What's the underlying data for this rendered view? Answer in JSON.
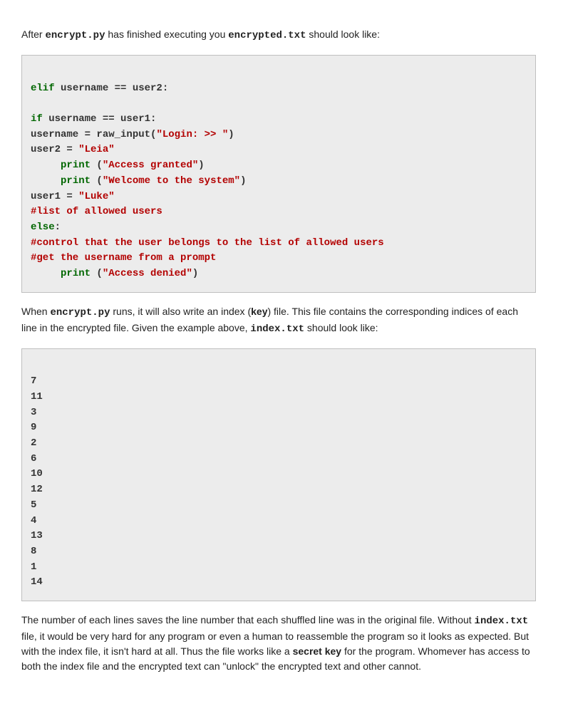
{
  "paragraphs": {
    "p1_t1": "After ",
    "p1_c1": "encrypt.py",
    "p1_t2": " has finished  executing you ",
    "p1_c2": "encrypted.txt",
    "p1_t3": " should look like:",
    "p2_t1": "When ",
    "p2_c1": "encrypt.py",
    "p2_t2": " runs, it will also write an index (",
    "p2_b1": "key",
    "p2_t3": ") file. This file contains the corresponding indices of each line in the encrypted file. Given the example above, ",
    "p2_c2": "index.txt",
    "p2_t4": " should look like:",
    "p3_t1": "The number of each lines saves the line number that each shuffled line was in the original file. Without ",
    "p3_c1": "index.txt",
    "p3_t2": " file, it would be very hard for any program or even a human to reassemble the program so it looks as expected. But with the index file, it isn't hard at all. Thus the file works like a ",
    "p3_b1": "secret key",
    "p3_t3": " for the program. Whomever has access to both the index file and the encrypted text can \"unlock\" the encrypted text and other cannot."
  },
  "code1": {
    "l1_kw": "elif",
    "l1_rest": " username == user2:",
    "l2_kw": "if",
    "l2_rest": " username == user1:",
    "l3_a": "username = raw_input(",
    "l3_s": "\"Login: >> \"",
    "l3_b": ")",
    "l4_a": "user2 = ",
    "l4_s": "\"Leia\"",
    "l5_indent": "     ",
    "l5_kw": "print",
    "l5_a": " (",
    "l5_s": "\"Access granted\"",
    "l5_b": ")",
    "l6_indent": "     ",
    "l6_kw": "print",
    "l6_a": " (",
    "l6_s": "\"Welcome to the system\"",
    "l6_b": ")",
    "l7_a": "user1 = ",
    "l7_s": "\"Luke\"",
    "l8": "#list of allowed users",
    "l9_kw": "else",
    "l9_rest": ":",
    "l10": "#control that the user belongs to the list of allowed users",
    "l11": "#get the username from a prompt",
    "l12_indent": "     ",
    "l12_kw": "print",
    "l12_a": " (",
    "l12_s": "\"Access denied\"",
    "l12_b": ")"
  },
  "code2": {
    "l1": "7",
    "l2": "11",
    "l3": "3",
    "l4": "9",
    "l5": "2",
    "l6": "6",
    "l7": "10",
    "l8": "12",
    "l9": "5",
    "l10": "4",
    "l11": "13",
    "l12": "8",
    "l13": "1",
    "l14": "14"
  }
}
